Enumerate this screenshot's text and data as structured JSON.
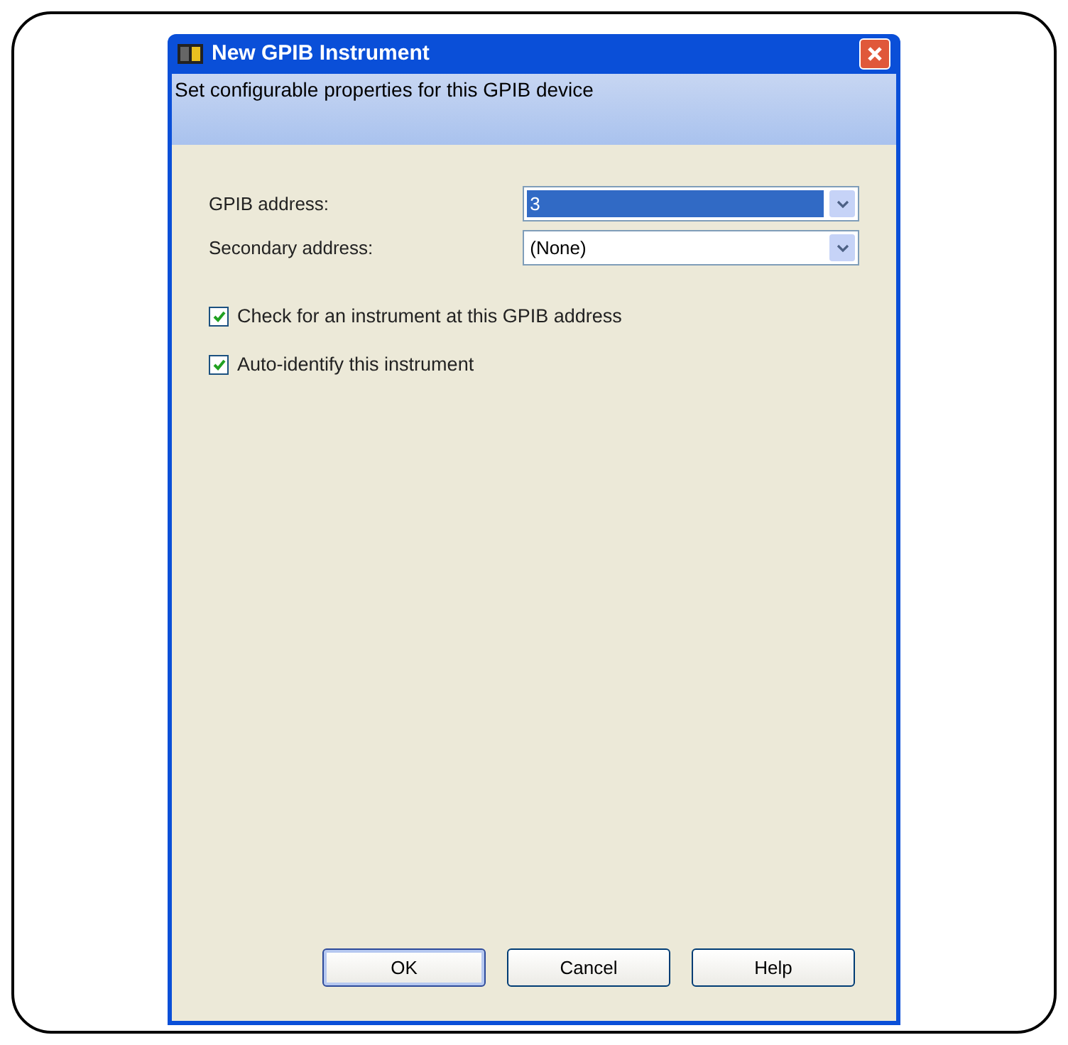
{
  "window": {
    "title": "New GPIB Instrument"
  },
  "header": {
    "text": "Set configurable properties for this GPIB device"
  },
  "fields": [
    {
      "label": "GPIB address:",
      "value": "3",
      "highlighted": true
    },
    {
      "label": "Secondary address:",
      "value": "(None)",
      "highlighted": false
    }
  ],
  "checkboxes": [
    {
      "label": "Check for an instrument at this GPIB address",
      "checked": true
    },
    {
      "label": "Auto-identify this instrument",
      "checked": true
    }
  ],
  "buttons": [
    {
      "label": "OK",
      "default": true
    },
    {
      "label": "Cancel",
      "default": false
    },
    {
      "label": "Help",
      "default": false
    }
  ]
}
